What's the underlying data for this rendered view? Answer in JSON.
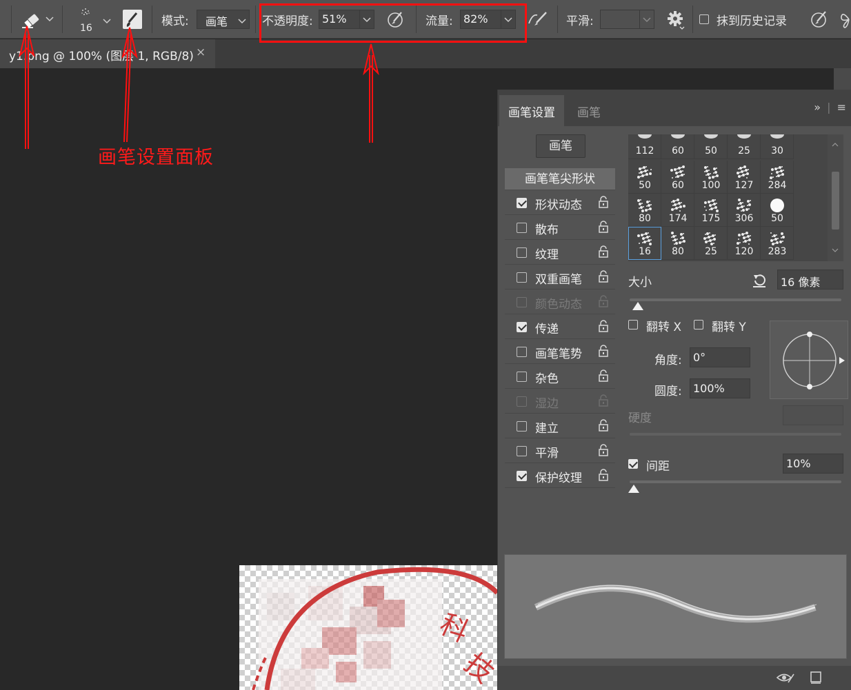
{
  "options_bar": {
    "brush_size": "16",
    "mode_label": "模式:",
    "mode_value": "画笔",
    "opacity_label": "不透明度:",
    "opacity_value": "51%",
    "flow_label": "流量:",
    "flow_value": "82%",
    "smoothing_label": "平滑:",
    "smoothing_value": "",
    "erase_history_label": "抹到历史记录"
  },
  "document_tab": {
    "title": "y1.png @ 100% (图层 1, RGB/8)",
    "close": "×"
  },
  "annotation": {
    "text": "画笔设置面板",
    "color": "#ff1010"
  },
  "panel": {
    "tabs": [
      "画笔设置",
      "画笔"
    ],
    "brush_button": "画笔",
    "tip_shape_header": "画笔笔尖形状",
    "options": [
      {
        "label": "形状动态",
        "checked": true,
        "disabled": false
      },
      {
        "label": "散布",
        "checked": false,
        "disabled": false
      },
      {
        "label": "纹理",
        "checked": false,
        "disabled": false
      },
      {
        "label": "双重画笔",
        "checked": false,
        "disabled": false
      },
      {
        "label": "颜色动态",
        "checked": false,
        "disabled": true
      },
      {
        "label": "传递",
        "checked": true,
        "disabled": false
      },
      {
        "label": "画笔笔势",
        "checked": false,
        "disabled": false
      },
      {
        "label": "杂色",
        "checked": false,
        "disabled": false
      },
      {
        "label": "湿边",
        "checked": false,
        "disabled": true
      },
      {
        "label": "建立",
        "checked": false,
        "disabled": false
      },
      {
        "label": "平滑",
        "checked": false,
        "disabled": false
      },
      {
        "label": "保护纹理",
        "checked": true,
        "disabled": false
      }
    ],
    "brush_tips": [
      [
        "112",
        "60",
        "50",
        "25",
        "30"
      ],
      [
        "50",
        "60",
        "100",
        "127",
        "284"
      ],
      [
        "80",
        "174",
        "175",
        "306",
        "50"
      ],
      [
        "16",
        "80",
        "25",
        "120",
        "283"
      ]
    ],
    "size_label": "大小",
    "size_value": "16 像素",
    "size_fraction": 0.04,
    "flip_x_label": "翻转 X",
    "flip_y_label": "翻转 Y",
    "angle_label": "角度:",
    "angle_value": "0°",
    "roundness_label": "圆度:",
    "roundness_value": "100%",
    "hardness_label": "硬度",
    "hardness_value": "",
    "spacing_label": "间距",
    "spacing_checked": true,
    "spacing_value": "10%",
    "spacing_fraction": 0.02
  }
}
